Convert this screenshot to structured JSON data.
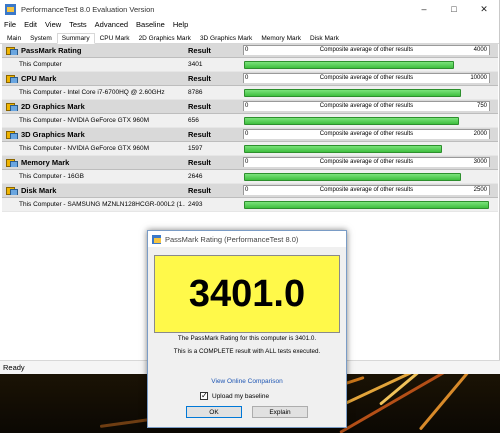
{
  "window": {
    "title": "PerformanceTest 8.0 Evaluation Version",
    "controls": [
      "–",
      "□",
      "✕"
    ]
  },
  "menu": [
    "File",
    "Edit",
    "View",
    "Tests",
    "Advanced",
    "Baseline",
    "Help"
  ],
  "tabs": [
    "Main",
    "System",
    "Summary",
    "CPU Mark",
    "2D Graphics Mark",
    "3D Graphics Mark",
    "Memory Mark",
    "Disk Mark"
  ],
  "active_tab": "Summary",
  "table": {
    "result_header": "Result",
    "scale_label": "Composite average of other results",
    "scale_min": "0",
    "sections": [
      {
        "title": "PassMark Rating",
        "row_label": "This Computer",
        "value": "3401",
        "scale_max": "4000",
        "fill": 0.85
      },
      {
        "title": "CPU Mark",
        "row_label": "This Computer - Intel Core i7-6700HQ @ 2.60GHz",
        "value": "8786",
        "scale_max": "10000",
        "fill": 0.88
      },
      {
        "title": "2D Graphics Mark",
        "row_label": "This Computer - NVIDIA GeForce GTX 960M",
        "value": "656",
        "scale_max": "750",
        "fill": 0.87
      },
      {
        "title": "3D Graphics Mark",
        "row_label": "This Computer - NVIDIA GeForce GTX 960M",
        "value": "1597",
        "scale_max": "2000",
        "fill": 0.8
      },
      {
        "title": "Memory Mark",
        "row_label": "This Computer - 16GB",
        "value": "2646",
        "scale_max": "3000",
        "fill": 0.88
      },
      {
        "title": "Disk Mark",
        "row_label": "This Computer - SAMSUNG MZNLN128HCGR-000L2 (1...",
        "value": "2493",
        "scale_max": "2500",
        "fill": 0.99
      }
    ]
  },
  "status": "Ready",
  "dialog": {
    "title": "PassMark Rating (PerformanceTest 8.0)",
    "rating": "3401.0",
    "line1": "The PassMark Rating for this computer is 3401.0.",
    "line2": "This is a COMPLETE result with ALL tests executed.",
    "link": "View Online Comparison",
    "checkbox_label": "Upload my baseline",
    "checkbox_checked": true,
    "ok": "OK",
    "explain": "Explain"
  },
  "colors": {
    "bar_fill": "#3fbf3f",
    "rating_bg": "#fff94a",
    "link": "#1d55b3"
  }
}
